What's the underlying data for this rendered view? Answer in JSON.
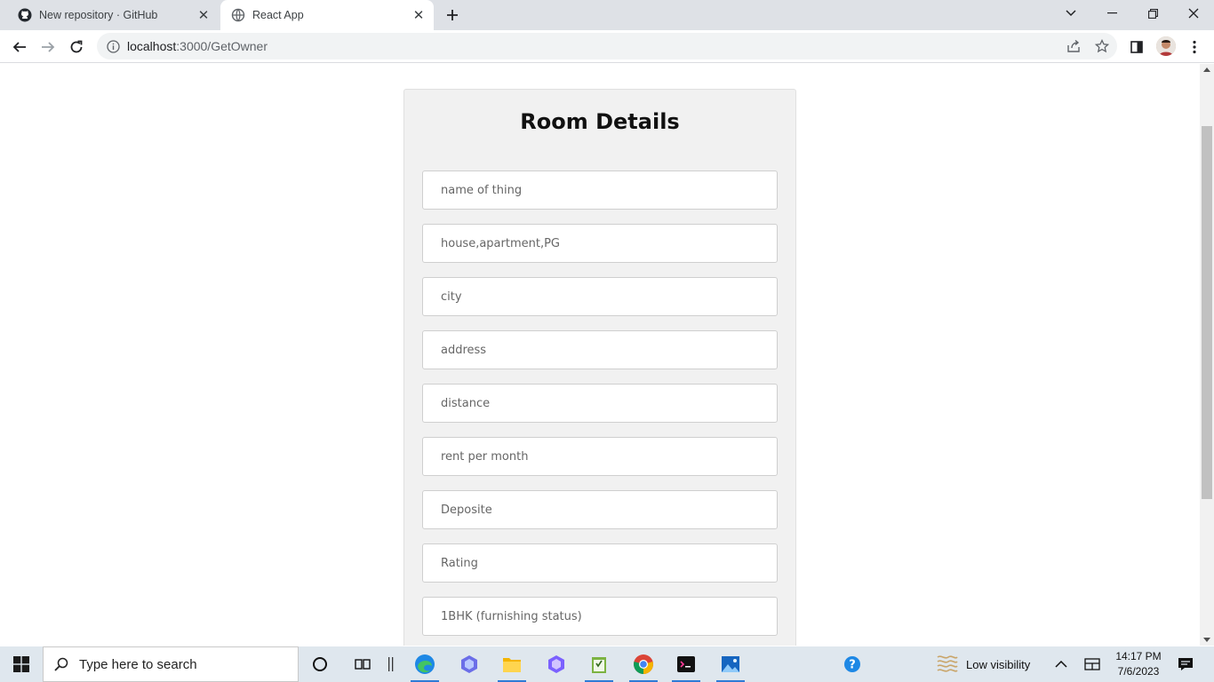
{
  "browser": {
    "tabs": [
      {
        "title": "New repository · GitHub",
        "icon": "github-icon",
        "active": false
      },
      {
        "title": "React App",
        "icon": "globe-icon",
        "active": true
      }
    ],
    "url_host": "localhost",
    "url_path": ":3000/GetOwner"
  },
  "page": {
    "heading": "Room Details",
    "fields": [
      {
        "placeholder": "name of thing"
      },
      {
        "placeholder": "house,apartment,PG"
      },
      {
        "placeholder": "city"
      },
      {
        "placeholder": "address"
      },
      {
        "placeholder": "distance"
      },
      {
        "placeholder": "rent per month"
      },
      {
        "placeholder": "Deposite"
      },
      {
        "placeholder": "Rating"
      },
      {
        "placeholder": "1BHK (furnishing status)"
      }
    ]
  },
  "taskbar": {
    "search_placeholder": "Type here to search",
    "weather_text": "Low visibility",
    "time": "14:17 PM",
    "date": "7/6/2023"
  },
  "colors": {
    "tabstrip": "#dee1e6",
    "card_bg": "#f1f1f1",
    "taskbar_bg": "#dfe7ee",
    "accent": "#2f7bd6"
  }
}
